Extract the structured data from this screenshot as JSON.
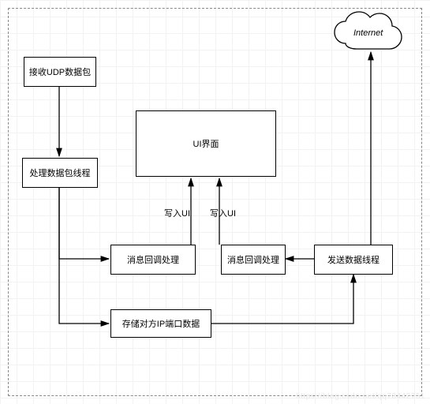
{
  "nodes": {
    "recv_udp": "接收UDP数据包",
    "proc_thread": "处理数据包线程",
    "ui_panel": "UI界面",
    "msg_cb_left": "消息回调处理",
    "msg_cb_right": "消息回调处理",
    "send_thread": "发送数据线程",
    "store_ip": "存储对方IP端口数据",
    "internet": "Internet"
  },
  "edge_labels": {
    "write_ui_1": "写入UI",
    "write_ui_2": "写入UI"
  },
  "watermark": "https://blog.csdn.net/qq78442751"
}
